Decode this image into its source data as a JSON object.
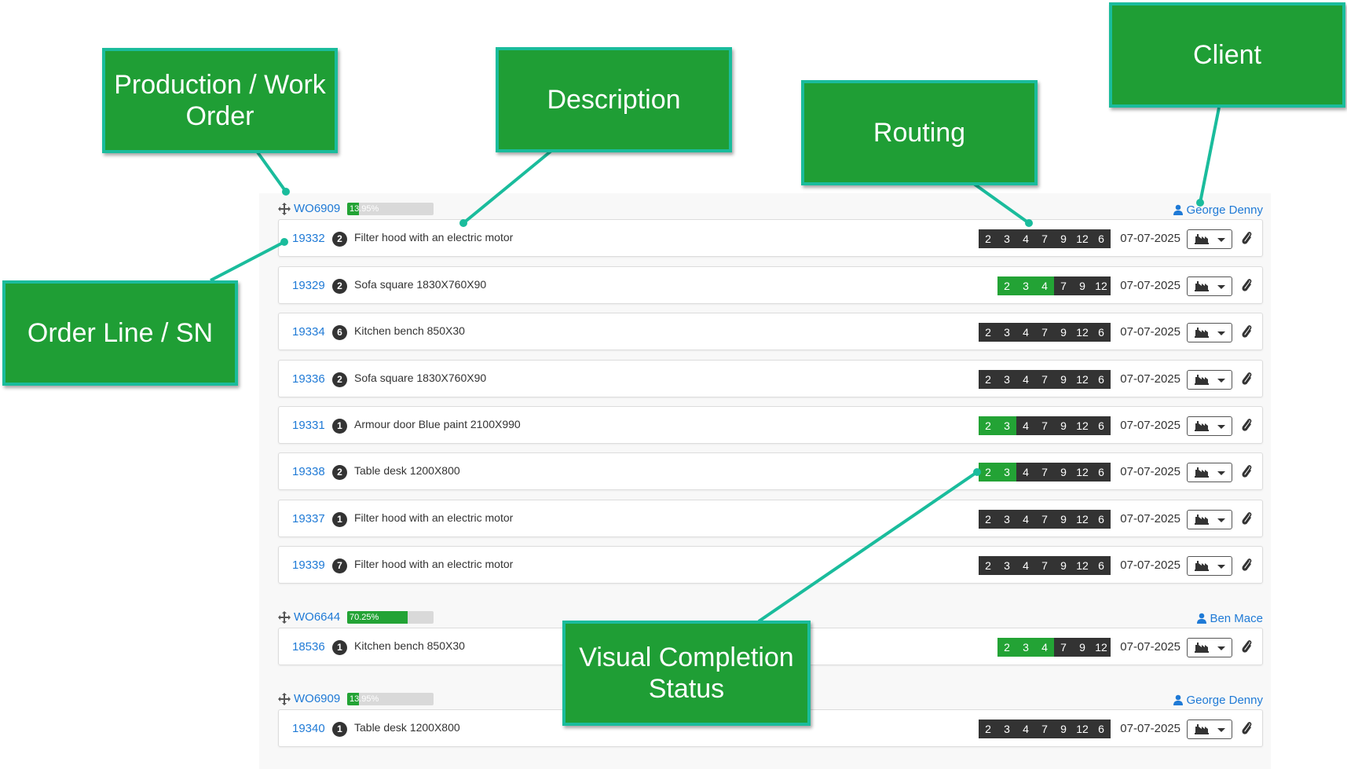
{
  "callouts": {
    "production_work_order": "Production / Work Order",
    "description": "Description",
    "routing": "Routing",
    "client": "Client",
    "order_line_sn": "Order Line / SN",
    "visual_completion_status": "Visual Completion Status"
  },
  "icons": {
    "move": "move-arrows-icon",
    "user": "user-icon",
    "factory": "factory-icon",
    "dropdown": "caret-down-icon",
    "attachment": "paperclip-icon"
  },
  "colors": {
    "link": "#1f7ad6",
    "step_done": "#23a335",
    "step_pending": "#333333",
    "callout_bg": "#1f9e35",
    "callout_border": "#1abc9c"
  },
  "groups": [
    {
      "work_order": "WO6909",
      "progress_label": "13.95%",
      "progress": 0.1395,
      "client": "George Denny",
      "lines": [
        {
          "sn": "19332",
          "qty": "2",
          "description": "Filter hood with an electric motor",
          "steps": [
            "2",
            "3",
            "4",
            "7",
            "9",
            "12",
            "6"
          ],
          "done": 0,
          "date": "07-07-2025"
        },
        {
          "sn": "19329",
          "qty": "2",
          "description": "Sofa square 1830X760X90",
          "steps": [
            "2",
            "3",
            "4",
            "7",
            "9",
            "12"
          ],
          "done": 3,
          "date": "07-07-2025"
        },
        {
          "sn": "19334",
          "qty": "6",
          "description": "Kitchen bench 850X30",
          "steps": [
            "2",
            "3",
            "4",
            "7",
            "9",
            "12",
            "6"
          ],
          "done": 0,
          "date": "07-07-2025"
        },
        {
          "sn": "19336",
          "qty": "2",
          "description": "Sofa square 1830X760X90",
          "steps": [
            "2",
            "3",
            "4",
            "7",
            "9",
            "12",
            "6"
          ],
          "done": 0,
          "date": "07-07-2025"
        },
        {
          "sn": "19331",
          "qty": "1",
          "description": "Armour door Blue paint 2100X990",
          "steps": [
            "2",
            "3",
            "4",
            "7",
            "9",
            "12",
            "6"
          ],
          "done": 2,
          "date": "07-07-2025"
        },
        {
          "sn": "19338",
          "qty": "2",
          "description": "Table desk 1200X800",
          "steps": [
            "2",
            "3",
            "4",
            "7",
            "9",
            "12",
            "6"
          ],
          "done": 2,
          "date": "07-07-2025"
        },
        {
          "sn": "19337",
          "qty": "1",
          "description": "Filter hood with an electric motor",
          "steps": [
            "2",
            "3",
            "4",
            "7",
            "9",
            "12",
            "6"
          ],
          "done": 0,
          "date": "07-07-2025"
        },
        {
          "sn": "19339",
          "qty": "7",
          "description": "Filter hood with an electric motor",
          "steps": [
            "2",
            "3",
            "4",
            "7",
            "9",
            "12",
            "6"
          ],
          "done": 0,
          "date": "07-07-2025"
        }
      ]
    },
    {
      "work_order": "WO6644",
      "progress_label": "70.25%",
      "progress": 0.7025,
      "client": "Ben Mace",
      "lines": [
        {
          "sn": "18536",
          "qty": "1",
          "description": "Kitchen bench 850X30",
          "steps": [
            "2",
            "3",
            "4",
            "7",
            "9",
            "12"
          ],
          "done": 3,
          "date": "07-07-2025"
        }
      ]
    },
    {
      "work_order": "WO6909",
      "progress_label": "13.95%",
      "progress": 0.1395,
      "client": "George Denny",
      "lines": [
        {
          "sn": "19340",
          "qty": "1",
          "description": "Table desk 1200X800",
          "steps": [
            "2",
            "3",
            "4",
            "7",
            "9",
            "12",
            "6"
          ],
          "done": 0,
          "date": "07-07-2025"
        }
      ]
    }
  ]
}
